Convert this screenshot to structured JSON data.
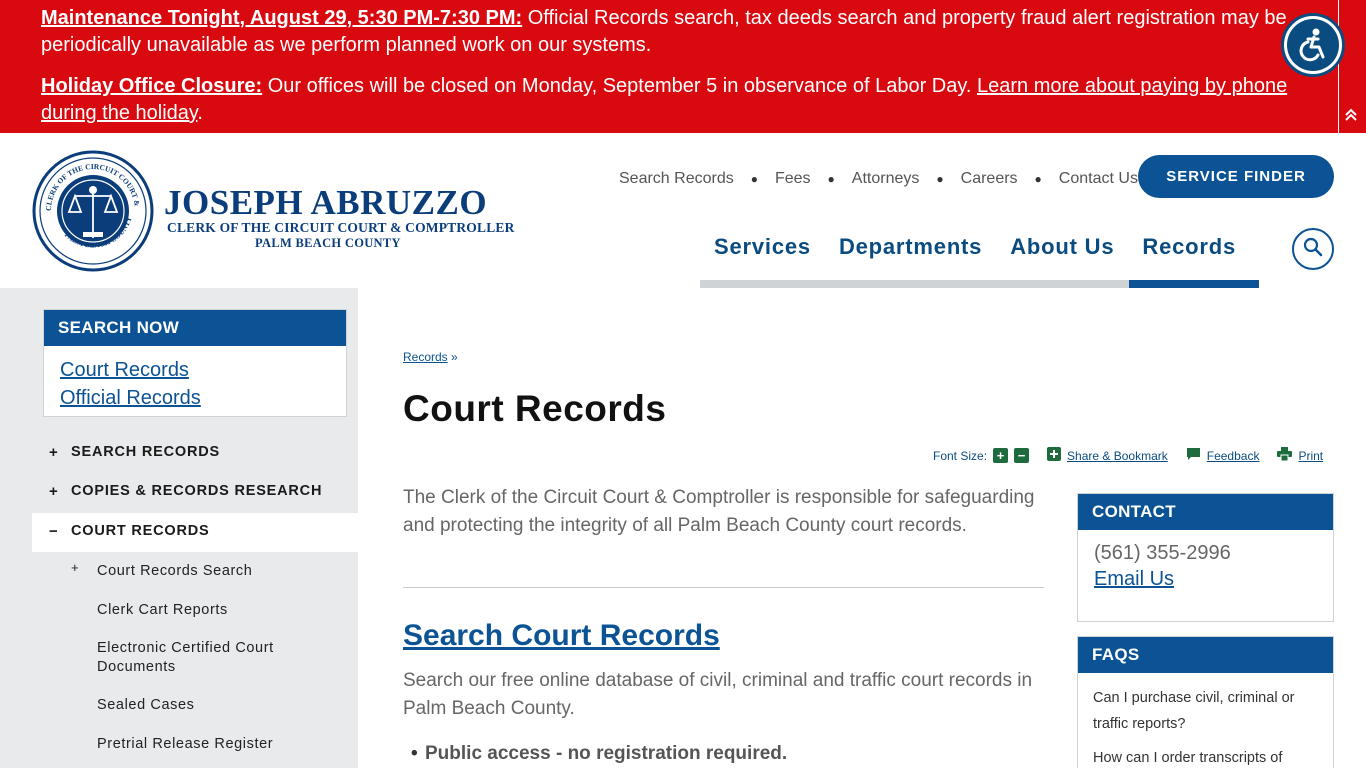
{
  "alert": {
    "item1_title": "Maintenance Tonight, August 29, 5:30 PM-7:30 PM:",
    "item1_text": " Official Records search, tax deeds search and property fraud alert registration may be periodically unavailable as we perform planned work on our systems.",
    "item2_title": "Holiday Office Closure:",
    "item2_text": " Our offices will be closed on Monday, September 5 in observance of Labor Day. ",
    "item2_link": "Learn more about paying by phone during the holiday",
    "item2_end": "."
  },
  "header": {
    "logo_name": "JOSEPH ABRUZZO",
    "logo_sub1": "CLERK OF THE CIRCUIT COURT & COMPTROLLER",
    "logo_sub2": "PALM BEACH COUNTY",
    "seal_text_top": "CLERK OF THE CIRCUIT COURT & COMPTROLLER",
    "seal_text_bottom": "PALM BEACH COUNTY",
    "utility": [
      "Search Records",
      "Fees",
      "Attorneys",
      "Careers",
      "Contact Us"
    ],
    "service_finder": "SERVICE FINDER",
    "main_nav": [
      "Services",
      "Departments",
      "About Us",
      "Records"
    ]
  },
  "sidebar": {
    "search_now_title": "SEARCH NOW",
    "search_links": [
      "Court Records",
      "Official Records"
    ],
    "sections": [
      {
        "toggle": "+",
        "label": "SEARCH RECORDS"
      },
      {
        "toggle": "+",
        "label": "COPIES & RECORDS RESEARCH"
      },
      {
        "toggle": "−",
        "label": "COURT RECORDS"
      }
    ],
    "sub_items": [
      "Court Records Search",
      "Clerk Cart Reports",
      "Electronic Certified Court Documents",
      "Sealed Cases",
      "Pretrial Release Register"
    ],
    "sub_plus": "+"
  },
  "main": {
    "breadcrumb": "Records",
    "breadcrumb_sep": " »",
    "title": "Court Records",
    "tools": {
      "font_size": "Font Size:",
      "plus": "+",
      "minus": "−",
      "share": "Share & Bookmark",
      "feedback": "Feedback",
      "print": "Print"
    },
    "intro": "The Clerk of the Circuit Court & Comptroller is responsible for safeguarding and protecting the integrity of all Palm Beach County court records.",
    "section_title": "Search Court Records",
    "section_text": "Search our free online database of civil, criminal and traffic court records in Palm Beach County.",
    "bullet1": "Public access - no registration required."
  },
  "contact": {
    "title": "CONTACT",
    "phone": "(561) 355-2996",
    "email": "Email Us"
  },
  "faqs": {
    "title": "FAQS",
    "items": [
      "Can I purchase civil, criminal or traffic reports?",
      "How can I order transcripts of"
    ]
  }
}
